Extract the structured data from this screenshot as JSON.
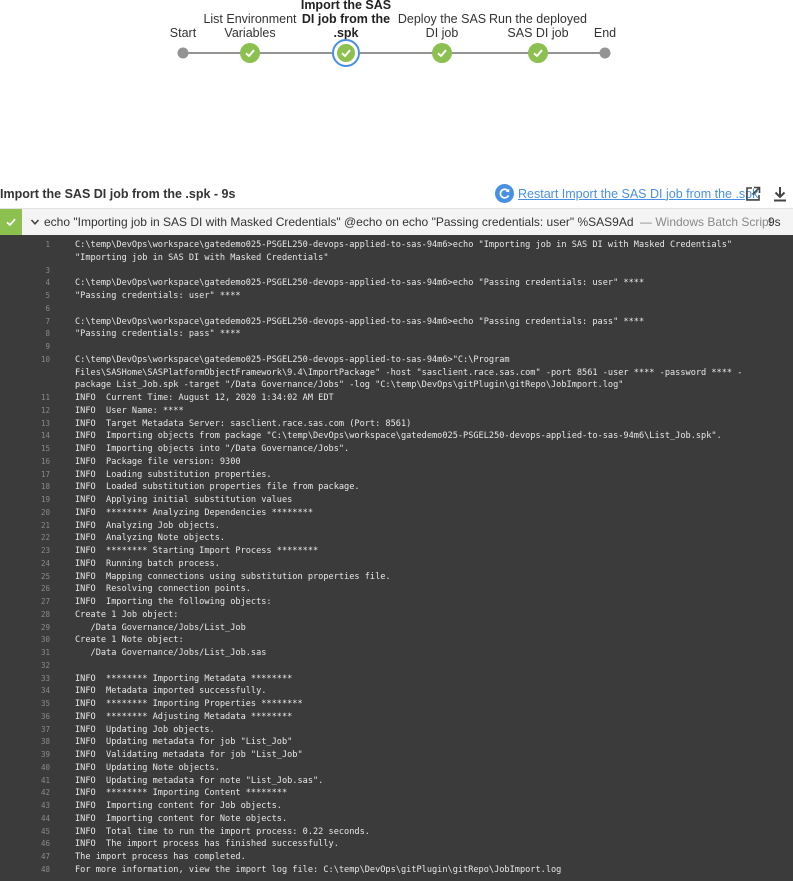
{
  "pipeline": {
    "stages": [
      {
        "label": "Start",
        "state": "start"
      },
      {
        "label": "List Environment Variables",
        "state": "success"
      },
      {
        "label": "Import the SAS DI job from the .spk",
        "state": "current"
      },
      {
        "label": "Deploy the SAS DI job",
        "state": "success"
      },
      {
        "label": "Run the deployed SAS DI job",
        "state": "success"
      },
      {
        "label": "End",
        "state": "end"
      }
    ]
  },
  "step": {
    "title": "Import the SAS DI job from the .spk - 9s",
    "restart_label": "Restart Import the SAS DI job from the .spk",
    "icons": {
      "restart": "restart-icon",
      "open": "open-external-icon",
      "download": "download-icon"
    }
  },
  "log_row": {
    "command": "echo \"Importing job in SAS DI with Masked Credentials\" @echo on echo \"Passing credentials: user\" %SAS9Admin% ec...",
    "type_label": "— Windows Batch Script",
    "duration": "9s",
    "status_color": "#8cc04f"
  },
  "console": {
    "lines": [
      {
        "n": "1",
        "text": "C:\\temp\\DevOps\\workspace\\gatedemo025-PSGEL250-devops-applied-to-sas-94m6>echo \"Importing job in SAS DI with Masked Credentials\""
      },
      {
        "n": "",
        "text": "\"Importing job in SAS DI with Masked Credentials\""
      },
      {
        "n": "3",
        "text": ""
      },
      {
        "n": "4",
        "text": "C:\\temp\\DevOps\\workspace\\gatedemo025-PSGEL250-devops-applied-to-sas-94m6>echo \"Passing credentials: user\" ****"
      },
      {
        "n": "5",
        "text": "\"Passing credentials: user\" ****"
      },
      {
        "n": "6",
        "text": ""
      },
      {
        "n": "7",
        "text": "C:\\temp\\DevOps\\workspace\\gatedemo025-PSGEL250-devops-applied-to-sas-94m6>echo \"Passing credentials: pass\" ****"
      },
      {
        "n": "8",
        "text": "\"Passing credentials: pass\" ****"
      },
      {
        "n": "9",
        "text": ""
      },
      {
        "n": "10",
        "text": "C:\\temp\\DevOps\\workspace\\gatedemo025-PSGEL250-devops-applied-to-sas-94m6>\"C:\\Program"
      },
      {
        "n": "",
        "text": "Files\\SASHome\\SASPlatformObjectFramework\\9.4\\ImportPackage\" -host \"sasclient.race.sas.com\" -port 8561 -user **** -password **** -"
      },
      {
        "n": "",
        "text": "package List_Job.spk -target \"/Data Governance/Jobs\" -log \"C:\\temp\\DevOps\\gitPlugin\\gitRepo\\JobImport.log\""
      },
      {
        "n": "11",
        "text": "INFO  Current Time: August 12, 2020 1:34:02 AM EDT"
      },
      {
        "n": "12",
        "text": "INFO  User Name: ****"
      },
      {
        "n": "13",
        "text": "INFO  Target Metadata Server: sasclient.race.sas.com (Port: 8561)"
      },
      {
        "n": "14",
        "text": "INFO  Importing objects from package \"C:\\temp\\DevOps\\workspace\\gatedemo025-PSGEL250-devops-applied-to-sas-94m6\\List_Job.spk\"."
      },
      {
        "n": "15",
        "text": "INFO  Importing objects into \"/Data Governance/Jobs\"."
      },
      {
        "n": "16",
        "text": "INFO  Package file version: 9300"
      },
      {
        "n": "17",
        "text": "INFO  Loading substitution properties."
      },
      {
        "n": "18",
        "text": "INFO  Loaded substitution properties file from package."
      },
      {
        "n": "19",
        "text": "INFO  Applying initial substitution values"
      },
      {
        "n": "20",
        "text": "INFO  ******** Analyzing Dependencies ********"
      },
      {
        "n": "21",
        "text": "INFO  Analyzing Job objects."
      },
      {
        "n": "22",
        "text": "INFO  Analyzing Note objects."
      },
      {
        "n": "23",
        "text": "INFO  ******** Starting Import Process ********"
      },
      {
        "n": "24",
        "text": "INFO  Running batch process."
      },
      {
        "n": "25",
        "text": "INFO  Mapping connections using substitution properties file."
      },
      {
        "n": "26",
        "text": "INFO  Resolving connection points."
      },
      {
        "n": "27",
        "text": "INFO  Importing the following objects:"
      },
      {
        "n": "28",
        "text": "Create 1 Job object:"
      },
      {
        "n": "29",
        "text": "   /Data Governance/Jobs/List_Job"
      },
      {
        "n": "30",
        "text": "Create 1 Note object:"
      },
      {
        "n": "31",
        "text": "   /Data Governance/Jobs/List_Job.sas"
      },
      {
        "n": "32",
        "text": ""
      },
      {
        "n": "33",
        "text": "INFO  ******** Importing Metadata ********"
      },
      {
        "n": "34",
        "text": "INFO  Metadata imported successfully."
      },
      {
        "n": "35",
        "text": "INFO  ******** Importing Properties ********"
      },
      {
        "n": "36",
        "text": "INFO  ******** Adjusting Metadata ********"
      },
      {
        "n": "37",
        "text": "INFO  Updating Job objects."
      },
      {
        "n": "38",
        "text": "INFO  Updating metadata for job \"List_Job\""
      },
      {
        "n": "39",
        "text": "INFO  Validating metadata for job \"List_Job\""
      },
      {
        "n": "40",
        "text": "INFO  Updating Note objects."
      },
      {
        "n": "41",
        "text": "INFO  Updating metadata for note \"List_Job.sas\"."
      },
      {
        "n": "42",
        "text": "INFO  ******** Importing Content ********"
      },
      {
        "n": "43",
        "text": "INFO  Importing content for Job objects."
      },
      {
        "n": "44",
        "text": "INFO  Importing content for Note objects."
      },
      {
        "n": "45",
        "text": "INFO  Total time to run the import process: 0.22 seconds."
      },
      {
        "n": "46",
        "text": "INFO  The import process has finished successfully."
      },
      {
        "n": "47",
        "text": "The import process has completed."
      },
      {
        "n": "48",
        "text": "For more information, view the import log file: C:\\temp\\DevOps\\gitPlugin\\gitRepo\\JobImport.log"
      }
    ]
  }
}
